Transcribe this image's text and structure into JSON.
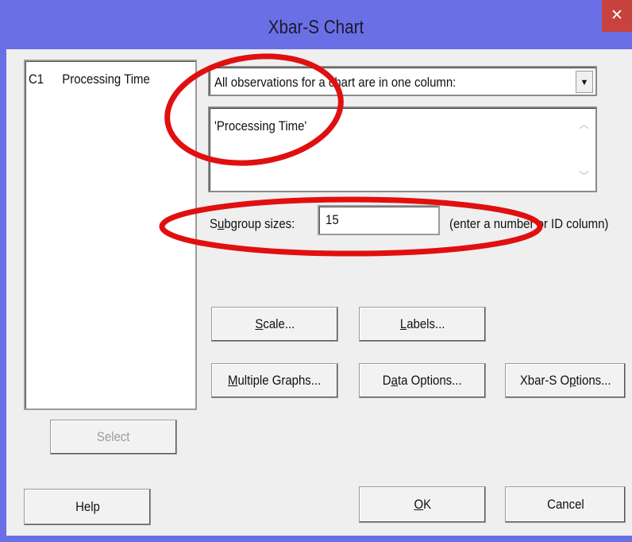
{
  "window": {
    "title": "Xbar-S Chart",
    "close_glyph": "✕"
  },
  "variables": [
    {
      "id": "C1",
      "name": "Processing Time"
    }
  ],
  "data_arrangement": {
    "selected": "All observations for a chart are in one column:"
  },
  "columns_field": {
    "value": "'Processing Time'"
  },
  "subgroup": {
    "label_pre": "S",
    "label_accel": "u",
    "label_post": "bgroup sizes:",
    "value": "15",
    "hint": "(enter a number or ID column)"
  },
  "buttons": {
    "scale": {
      "accel": "S",
      "rest": "cale..."
    },
    "labels": {
      "accel": "L",
      "rest": "abels..."
    },
    "multiple_graphs": {
      "accel": "M",
      "rest": "ultiple Graphs..."
    },
    "data_options": {
      "pre": "D",
      "accel": "a",
      "rest": "ta Options..."
    },
    "xbar_s_options": {
      "pre": "Xbar-S O",
      "accel": "p",
      "rest": "tions..."
    },
    "select": "Select",
    "help": "Help",
    "ok": {
      "accel": "O",
      "rest": "K"
    },
    "cancel": "Cancel"
  },
  "annotation_color": "#e01010"
}
